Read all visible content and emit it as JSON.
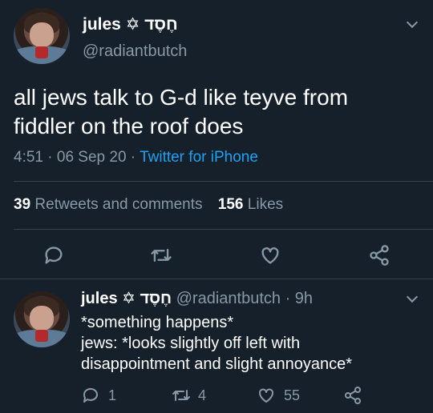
{
  "tweet": {
    "display_name": "jules ✡ חֶסֶד",
    "handle": "@radiantbutch",
    "text_line1": "all jews talk to G-d like teyve from",
    "text_line2": "fiddler on the roof does",
    "time": "4:51",
    "date": "06 Sep 20",
    "separator1": "·",
    "separator2": "·",
    "source": "Twitter for iPhone",
    "retweets_count": "39",
    "retweets_label": "Retweets and comments",
    "likes_count": "156",
    "likes_label": "Likes"
  },
  "reply": {
    "display_name": "jules ✡ חֶסֶד",
    "handle_time": "@radiantbutch · 9h",
    "line1": "*something happens*",
    "line2": "jews: *looks slightly off left with",
    "line3": "disappointment and slight annoyance*",
    "reply_count": "1",
    "retweet_count": "4",
    "like_count": "55"
  },
  "colors": {
    "background": "#15202b",
    "muted": "#8899a6",
    "accent": "#1da1f2",
    "divider": "#38444d"
  },
  "icons": [
    "chevron-down-icon",
    "reply-icon",
    "retweet-icon",
    "like-icon",
    "share-icon"
  ]
}
